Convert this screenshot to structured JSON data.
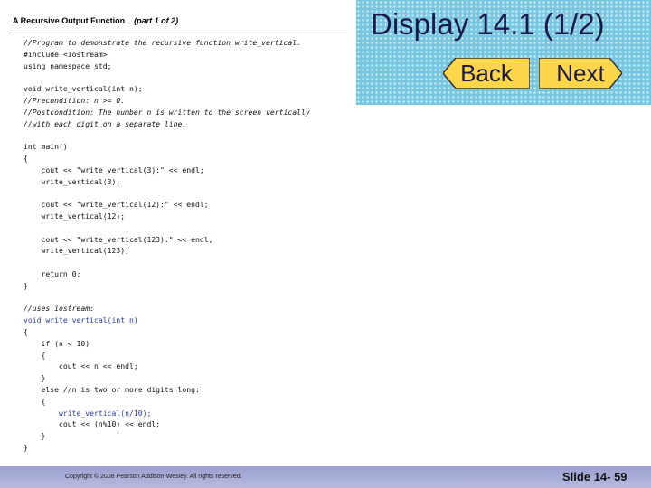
{
  "panel": {
    "title": "A Recursive Output Function",
    "part": "(part 1 of 2)"
  },
  "code_lines": [
    {
      "text": "//Program to demonstrate the recursive function write_vertical.",
      "style": "it"
    },
    {
      "text": "#include <iostream>",
      "style": ""
    },
    {
      "text": "using namespace std;",
      "style": ""
    },
    {
      "text": "",
      "style": ""
    },
    {
      "text": "void write_vertical(int n);",
      "style": ""
    },
    {
      "text": "//Precondition: n >= 0.",
      "style": "it"
    },
    {
      "text": "//Postcondition: The number n is written to the screen vertically",
      "style": "it"
    },
    {
      "text": "//with each digit on a separate line.",
      "style": "it"
    },
    {
      "text": "",
      "style": ""
    },
    {
      "text": "int main()",
      "style": ""
    },
    {
      "text": "{",
      "style": ""
    },
    {
      "text": "    cout << \"write_vertical(3):\" << endl;",
      "style": ""
    },
    {
      "text": "    write_vertical(3);",
      "style": ""
    },
    {
      "text": "",
      "style": ""
    },
    {
      "text": "    cout << \"write_vertical(12):\" << endl;",
      "style": ""
    },
    {
      "text": "    write_vertical(12);",
      "style": ""
    },
    {
      "text": "",
      "style": ""
    },
    {
      "text": "    cout << \"write_vertical(123):\" << endl;",
      "style": ""
    },
    {
      "text": "    write_vertical(123);",
      "style": ""
    },
    {
      "text": "",
      "style": ""
    },
    {
      "text": "    return 0;",
      "style": ""
    },
    {
      "text": "}",
      "style": ""
    },
    {
      "text": "",
      "style": ""
    },
    {
      "text": "//uses iostream:",
      "style": "it"
    },
    {
      "text": "void write_vertical(int n)",
      "style": "hl"
    },
    {
      "text": "{",
      "style": ""
    },
    {
      "text": "    if (n < 10)",
      "style": ""
    },
    {
      "text": "    {",
      "style": ""
    },
    {
      "text": "        cout << n << endl;",
      "style": ""
    },
    {
      "text": "    }",
      "style": ""
    },
    {
      "text": "    else //n is two or more digits long:",
      "style": ""
    },
    {
      "text": "    {",
      "style": ""
    },
    {
      "text": "        write_vertical(n/10);",
      "style": "hl"
    },
    {
      "text": "        cout << (n%10) << endl;",
      "style": ""
    },
    {
      "text": "    }",
      "style": ""
    },
    {
      "text": "}",
      "style": ""
    }
  ],
  "header": {
    "title": "Display 14.1 (1/2)",
    "back_label": "Back",
    "next_label": "Next",
    "button_color": "#ffd54a",
    "panel_color": "#79c6e0"
  },
  "footer": {
    "copyright": "Copyright © 2008 Pearson Addison-Wesley. All rights reserved.",
    "slide_number": "Slide 14- 59"
  }
}
